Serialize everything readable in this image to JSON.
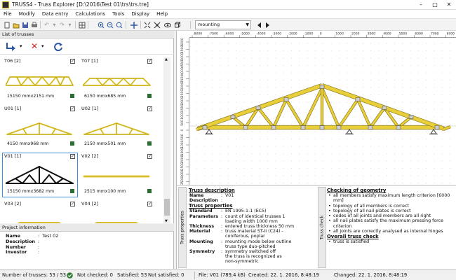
{
  "window": {
    "title": "TRUSS4 - Truss Explorer [D:\\2016\\Test 01\\trs\\trs.tre]",
    "minimize_glyph": "–",
    "maximize_glyph": "□",
    "close_glyph": "✕"
  },
  "menu": [
    "File",
    "Modify",
    "Data entry",
    "Calculations",
    "Tools",
    "Display",
    "Help"
  ],
  "toolbar": {
    "view_value": "mounting",
    "icons": [
      "new-icon",
      "open-icon",
      "save-icon",
      "print-icon",
      "undo-icon",
      "redo-icon",
      "zoom-in-icon",
      "zoom-out-icon",
      "zoom-area-icon",
      "zoom-all-icon",
      "pan-icon",
      "fit-icon",
      "fit-width-icon",
      "view-icon",
      "3d-icon"
    ]
  },
  "list_panel": {
    "title": "List of trusses",
    "trusses": [
      {
        "name": "T06 [2]",
        "dim": "15150 mmx2151 mm",
        "checked": true,
        "shape": "flat"
      },
      {
        "name": "T07 [1]",
        "dim": "6150 mmx685 mm",
        "checked": true,
        "shape": "flat-short"
      },
      {
        "name": "U01 [1]",
        "dim": "4150 mmx968 mm",
        "checked": true,
        "shape": "pitched-small"
      },
      {
        "name": "U02 [1]",
        "dim": "2150 mmx501 mm",
        "checked": true,
        "shape": "pitched-small"
      },
      {
        "name": "V01 [1]",
        "dim": "15150 mmx3682 mm",
        "checked": true,
        "shape": "pitched-large",
        "selected": true
      },
      {
        "name": "V02 [2]",
        "dim": "2515 mmx100 mm",
        "checked": true,
        "shape": "beam"
      },
      {
        "name": "V03 [2]",
        "dim": "",
        "checked": true,
        "shape": "partial"
      },
      {
        "name": "V04 [2]",
        "dim": "",
        "checked": true,
        "shape": "partial"
      }
    ]
  },
  "project": {
    "title": "Project information",
    "fields": [
      {
        "label": "Name",
        "value": "Test 02"
      },
      {
        "label": "Description",
        "value": ""
      },
      {
        "label": "Number",
        "value": ""
      },
      {
        "label": "Investor",
        "value": ""
      }
    ]
  },
  "drawing": {
    "ruler_top": [
      "-8000",
      "-7000",
      "-6000",
      "-5000",
      "-4000",
      "-3000",
      "-2000",
      "-1000",
      "0",
      "1000",
      "2000",
      "3000",
      "4000",
      "5000",
      "6000",
      "7000",
      "8000"
    ],
    "ruler_left": [
      "6000",
      "5500",
      "5000",
      "4500",
      "4000",
      "3500",
      "3000",
      "2500",
      "2000",
      "1500",
      "1000",
      "500",
      "0",
      "-500",
      "-1000",
      "-1500",
      "-2000",
      "-2500",
      "-3000",
      "-3500"
    ]
  },
  "tabs": {
    "left": "Truss properties",
    "right": "Truss check"
  },
  "truss_description": {
    "heading": "Truss description",
    "name_label": "Name",
    "name_value": "V01",
    "desc_label": "Description",
    "desc_value": "",
    "props_heading": "Truss properties",
    "rows": [
      {
        "k": "Standard",
        "v": "EN 1995-1-1 (EC5)"
      },
      {
        "k": "Parameters",
        "v": "count of identical trusses 1"
      },
      {
        "k": "",
        "v": "loading width 1000 mm"
      },
      {
        "k": "Thickness",
        "v": "entered truss thickness 50 mm"
      },
      {
        "k": "Material",
        "v": "truss material ST-II (C24) -"
      },
      {
        "k": "",
        "v": "coniferous, poplar"
      },
      {
        "k": "Mounting",
        "v": "mounting mode below outline"
      },
      {
        "k": "",
        "v": "truss type duo-pitched"
      },
      {
        "k": "Symmetry",
        "v": "symmetry switched off"
      },
      {
        "k": "",
        "v": "the truss is recognized as"
      },
      {
        "k": "",
        "v": "non-symmetric"
      }
    ]
  },
  "geometry_check": {
    "heading": "Checking of geometry",
    "items": [
      "all members satisfy maximum length criterion [6000 mm]",
      "topology of all members is correct",
      "topology of all nail plates is correct",
      "codes of all joints and members are all right",
      "all nail plates satisfy the maximum pressing force criterion",
      "all joints are correctly analysed as internal hinges"
    ],
    "overall_heading": "Overall truss check",
    "overall_items": [
      "truss is satisfied"
    ]
  },
  "status": {
    "count": "Number of trusses: 53 / 53",
    "not_checked": "Not checked: 0",
    "satisfied": "Satisfied: 53",
    "not_satisfied": "Not satisfied: 0",
    "file": "File: V01 (789,4 kB)",
    "created": "Created: 22. 1. 2016, 8:48:19",
    "changed": "Changed: 22. 1. 2016, 8:48:19"
  },
  "colors": {
    "timber": "#e8cf3a",
    "timber_edge": "#7a6a10",
    "selection": "#3b8de0",
    "status_ok": "#2e6d34"
  }
}
